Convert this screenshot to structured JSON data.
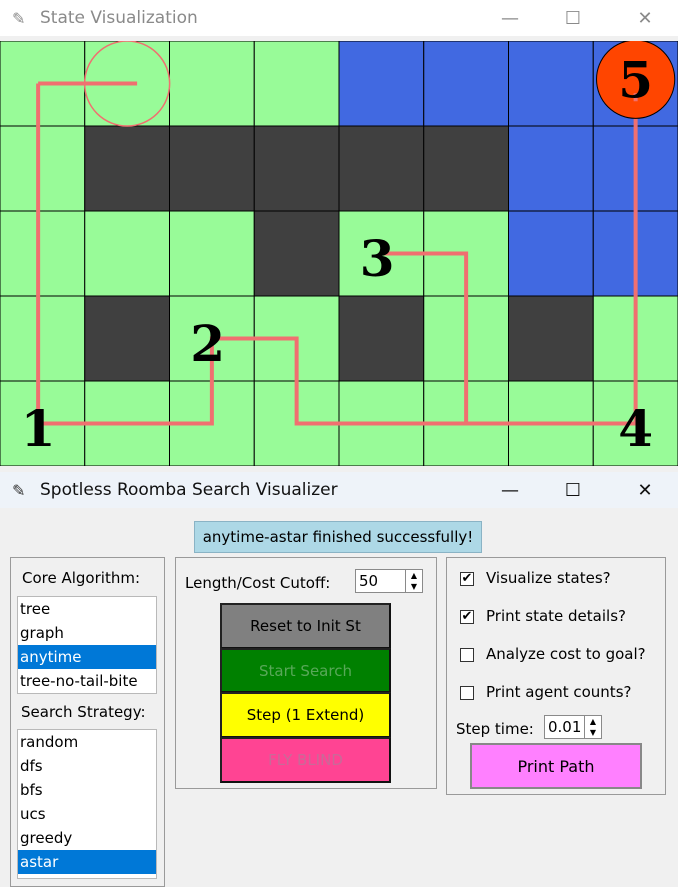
{
  "top_window": {
    "title": "State Visualization",
    "icon": "feather-icon",
    "min_icon": "—",
    "max_icon": "☐",
    "close_icon": "✕"
  },
  "grid": {
    "rows": 5,
    "cols": 8,
    "cells": [
      [
        "g",
        "g",
        "g",
        "g",
        "b",
        "b",
        "b",
        "b"
      ],
      [
        "g",
        "d",
        "d",
        "d",
        "d",
        "d",
        "b",
        "b"
      ],
      [
        "g",
        "g",
        "g",
        "d",
        "g",
        "g",
        "b",
        "b"
      ],
      [
        "g",
        "d",
        "g",
        "g",
        "d",
        "g",
        "d",
        "g"
      ],
      [
        "g",
        "g",
        "g",
        "g",
        "g",
        "g",
        "g",
        "g"
      ]
    ],
    "colors": {
      "g": "#98fb98",
      "b": "#4169e1",
      "d": "#404040",
      "line": "#f07070",
      "goal": "#ff4500",
      "grid": "#000000"
    },
    "path": [
      [
        0.45,
        0.5
      ],
      [
        0.45,
        4.5
      ],
      [
        2.5,
        4.5
      ],
      [
        2.5,
        3.5
      ],
      [
        3.5,
        3.5
      ],
      [
        3.5,
        4.5
      ],
      [
        5.5,
        4.5
      ],
      [
        5.5,
        2.5
      ],
      [
        4.5,
        2.5
      ]
    ],
    "path2": [
      [
        7.5,
        0.65
      ],
      [
        7.5,
        4.5
      ],
      [
        5.5,
        4.5
      ]
    ],
    "roomba": {
      "col": 1.5,
      "row": 0.5,
      "tail_to": [
        1.5,
        0.5
      ]
    },
    "markers": [
      {
        "label": "1",
        "col": 0.45,
        "row": 4.55
      },
      {
        "label": "2",
        "col": 2.45,
        "row": 3.55
      },
      {
        "label": "3",
        "col": 4.45,
        "row": 2.55
      },
      {
        "label": "4",
        "col": 7.5,
        "row": 4.55
      },
      {
        "label": "5",
        "col": 7.5,
        "row": 0.45
      }
    ]
  },
  "bottom_window": {
    "title": "Spotless Roomba Search Visualizer",
    "icon": "feather-icon",
    "min_icon": "—",
    "max_icon": "☐",
    "close_icon": "✕",
    "status": "anytime-astar finished successfully!",
    "core_algorithm_label": "Core Algorithm:",
    "core_algorithms": [
      {
        "label": "tree",
        "selected": false
      },
      {
        "label": "graph",
        "selected": false
      },
      {
        "label": "anytime",
        "selected": true
      },
      {
        "label": "tree-no-tail-bite",
        "selected": false
      }
    ],
    "search_strategy_label": "Search Strategy:",
    "search_strategies": [
      {
        "label": "random",
        "selected": false
      },
      {
        "label": "dfs",
        "selected": false
      },
      {
        "label": "bfs",
        "selected": false
      },
      {
        "label": "ucs",
        "selected": false
      },
      {
        "label": "greedy",
        "selected": false
      },
      {
        "label": "astar",
        "selected": true
      }
    ],
    "cutoff_label": "Length/Cost Cutoff:",
    "cutoff_value": "50",
    "buttons": {
      "reset": {
        "label": "Reset to Init St",
        "bg": "#808080",
        "fg": "#000000"
      },
      "start": {
        "label": "Start Search",
        "bg": "#008000",
        "fg": "#58a858"
      },
      "step": {
        "label": "Step (1 Extend)",
        "bg": "#ffff00",
        "fg": "#000000"
      },
      "fly": {
        "label": "FLY BLIND",
        "bg": "#ff4493",
        "fg": "#c96a98"
      }
    },
    "options": [
      {
        "label": "Visualize states?",
        "checked": true
      },
      {
        "label": "Print state details?",
        "checked": true
      },
      {
        "label": "Analyze cost to goal?",
        "checked": false
      },
      {
        "label": "Print agent counts?",
        "checked": false
      }
    ],
    "step_time_label": "Step time:",
    "step_time_value": "0.01",
    "print_path": {
      "label": "Print Path",
      "bg": "#ff80ff",
      "fg": "#000000"
    }
  }
}
